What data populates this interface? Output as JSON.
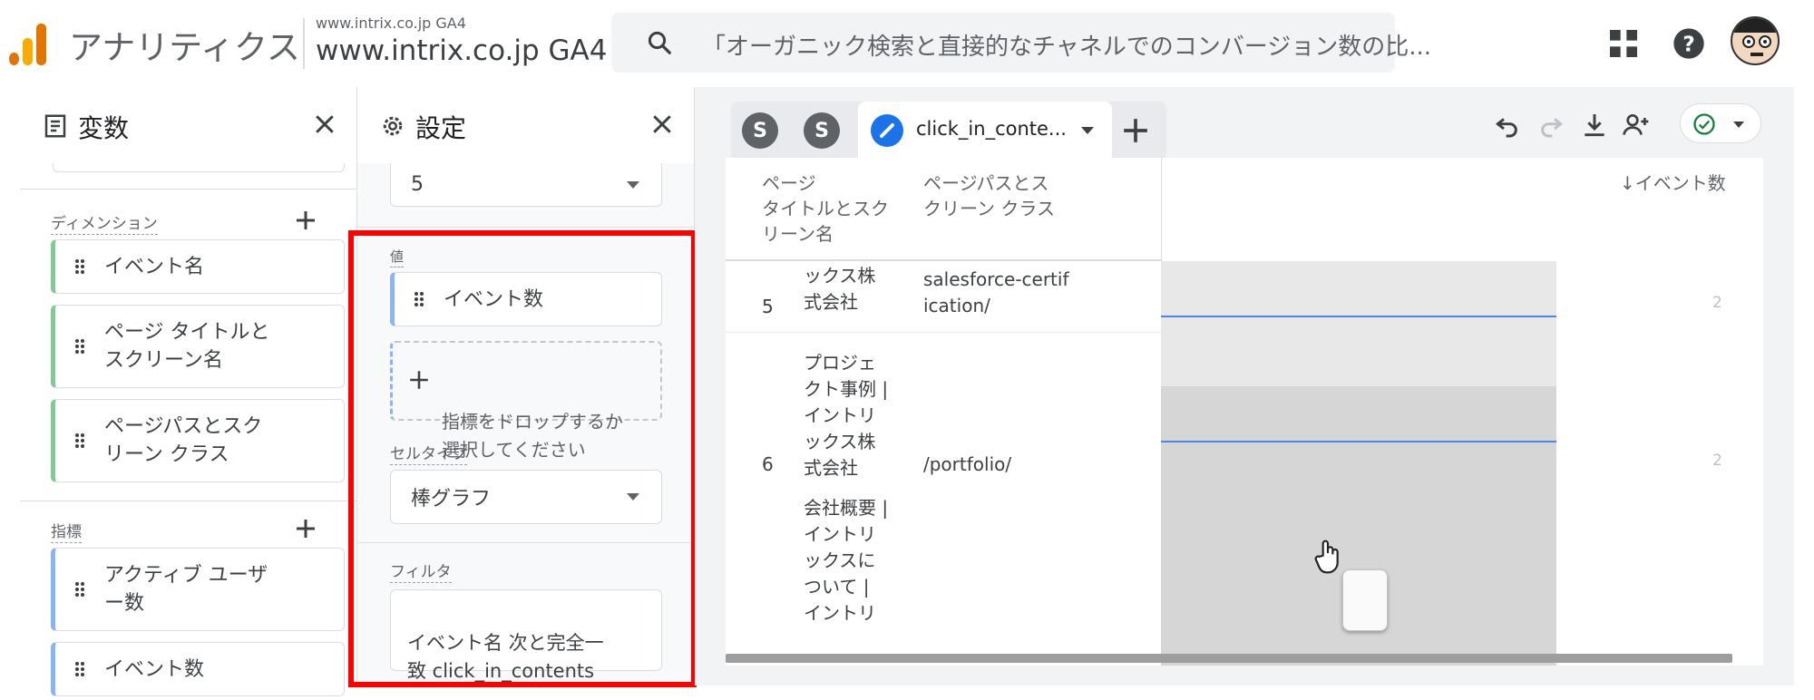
{
  "header": {
    "app_name": "アナリティクス",
    "property_small": "www.intrix.co.jp GA4",
    "property_name": "www.intrix.co.jp GA4",
    "search_text": "「オーガニック検索と直接的なチャネルでのコンバージョン数の比..."
  },
  "variables": {
    "title": "変数",
    "dimensions_label": "ディメンション",
    "dimensions": [
      {
        "label": "イベント名"
      },
      {
        "label": "ページ タイトルと\nスクリーン名"
      },
      {
        "label": "ページパスとスク\nリーン クラス"
      }
    ],
    "metrics_label": "指標",
    "metrics": [
      {
        "label": "アクティブ ユーザ\nー数"
      },
      {
        "label": "イベント数"
      }
    ]
  },
  "settings": {
    "title": "設定",
    "rows_value": "5",
    "value_label": "値",
    "value_metric": "イベント数",
    "drop_hint": "指標をドロップするか\n選択してください",
    "cell_type_label": "セルタイプ",
    "cell_type_value": "棒グラフ",
    "filter_label": "フィルタ",
    "filter_value": "イベント名 次と完全一\n致 click_in_contents"
  },
  "tabs": {
    "tab1": "S",
    "tab2": "S",
    "active_tab": "click_in_conte..."
  },
  "table": {
    "columns": [
      "ページ\nタイトルとスク\nリーン名",
      "ページパスとス\nクリーン クラス",
      "↓イベント数"
    ],
    "rows": [
      {
        "index": "5",
        "title": "ックス株\n式会社",
        "path": "salesforce-certif\nication/",
        "value": "2"
      },
      {
        "index": "6",
        "title": "プロジェ\nクト事例 |\nイントリ\nックス株\n式会社",
        "path": "/portfolio/",
        "value": "2"
      },
      {
        "index": "",
        "title": "会社概要 |\nイントリ\nックスに\nついて |\nイントリ",
        "path": "",
        "value": ""
      }
    ]
  },
  "colors": {
    "accent": "#1a73e8",
    "highlight_border": "#ff0000",
    "dimension_chip": "#81c995",
    "metric_chip": "#8ab4f8"
  }
}
